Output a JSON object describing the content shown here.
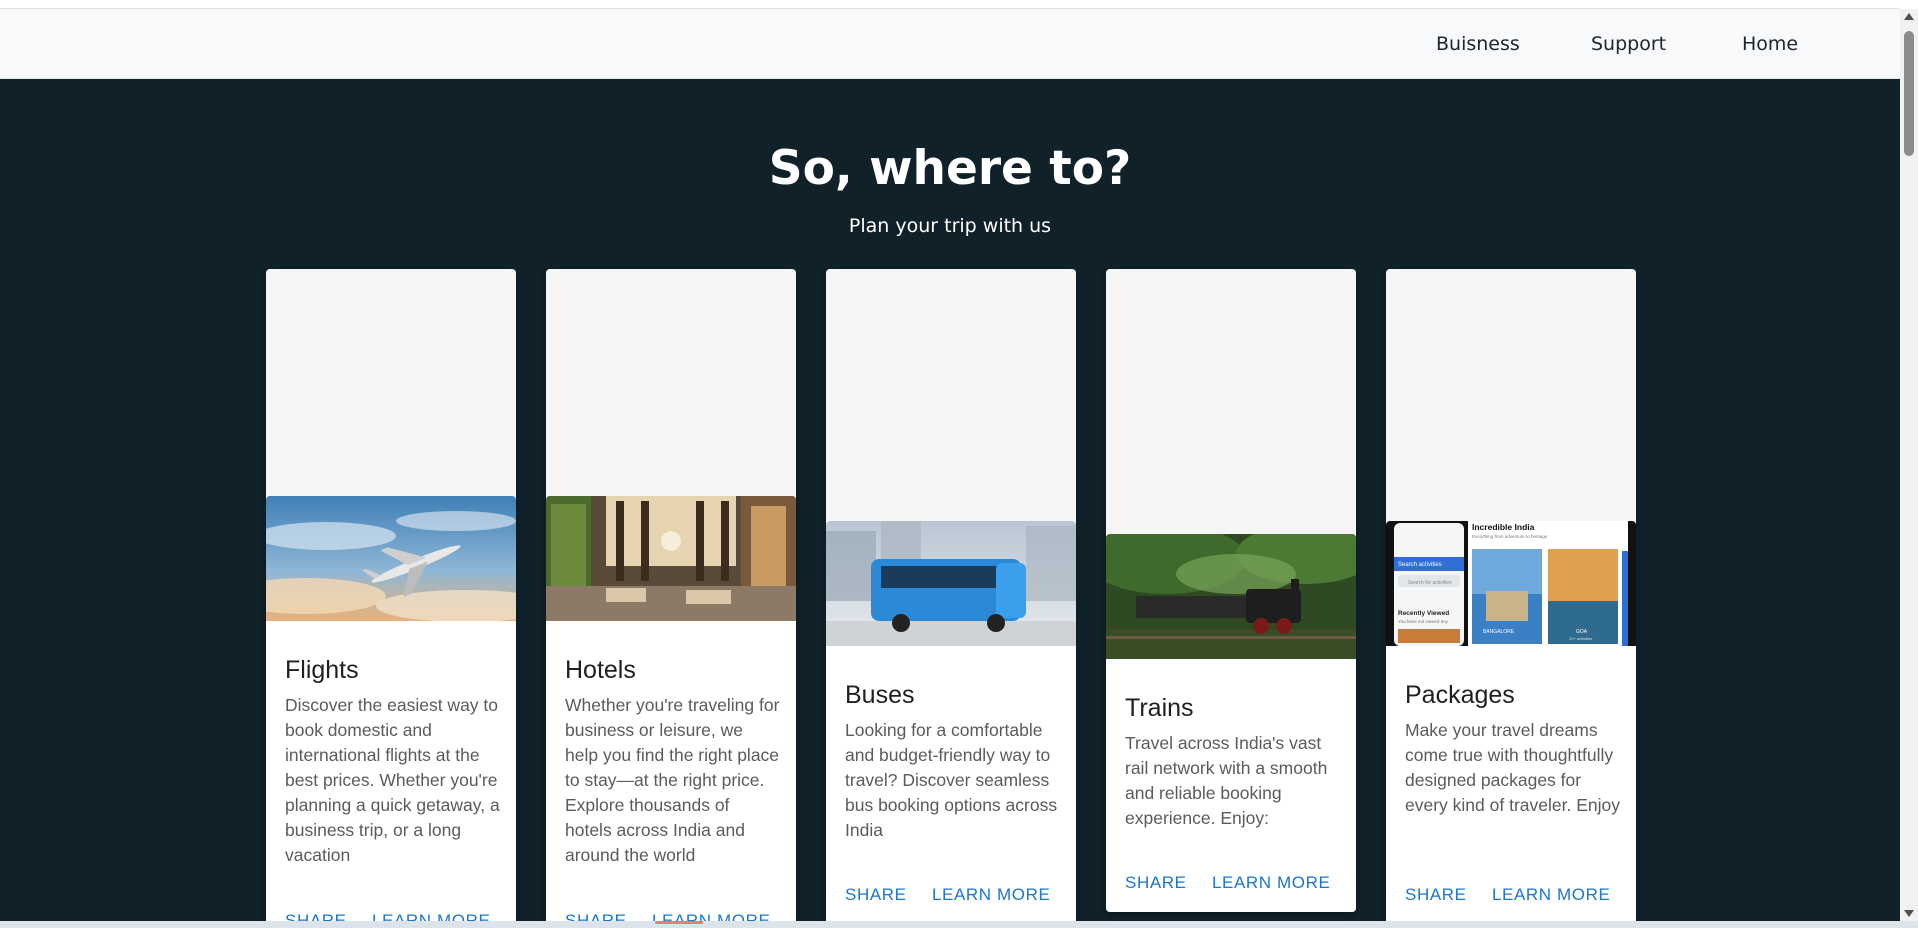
{
  "nav": {
    "items": [
      {
        "label": "Buisness"
      },
      {
        "label": "Support"
      },
      {
        "label": "Home"
      }
    ]
  },
  "hero": {
    "title": "So, where to?",
    "subtitle": "Plan your trip with us"
  },
  "cards": [
    {
      "title": "Flights",
      "description": "Discover the easiest way to book domestic and international flights at the best prices. Whether you're planning a quick getaway, a business trip, or a long vacation",
      "share_label": "SHARE",
      "learn_label": "LEARN MORE",
      "image_icon": "airplane-image"
    },
    {
      "title": "Hotels",
      "description": "Whether you're traveling for business or leisure, we help you find the right place to stay—at the right price. Explore thousands of hotels across India and around the world",
      "share_label": "SHARE",
      "learn_label": "LEARN MORE",
      "image_icon": "hotel-lobby-image"
    },
    {
      "title": "Buses",
      "description": "Looking for a comfortable and budget-friendly way to travel? Discover seamless bus booking options across India",
      "share_label": "SHARE",
      "learn_label": "LEARN MORE",
      "image_icon": "bus-image"
    },
    {
      "title": "Trains",
      "description": "Travel across India's vast rail network with a smooth and reliable booking experience. Enjoy:",
      "share_label": "SHARE",
      "learn_label": "LEARN MORE",
      "image_icon": "train-image"
    },
    {
      "title": "Packages",
      "description": "Make your travel dreams come true with thoughtfully designed packages for every kind of traveler. Enjoy",
      "share_label": "SHARE",
      "learn_label": "LEARN MORE",
      "image_icon": "packages-app-image",
      "image_text": {
        "heading": "Incredible India",
        "tagline": "Everything from adventure to heritage",
        "search_activities": "Search activities",
        "search_placeholder": "Search for activities",
        "recently_viewed": "Recently Viewed",
        "recent_note": "You have not viewed any",
        "city_1": "BANGALORE",
        "city_2": "GOA",
        "city_2_sub": "20+ activities"
      }
    }
  ],
  "colors": {
    "hero_bg": "#10212a",
    "navbar_bg": "#f8f9fa",
    "accent": "#1976d2"
  }
}
